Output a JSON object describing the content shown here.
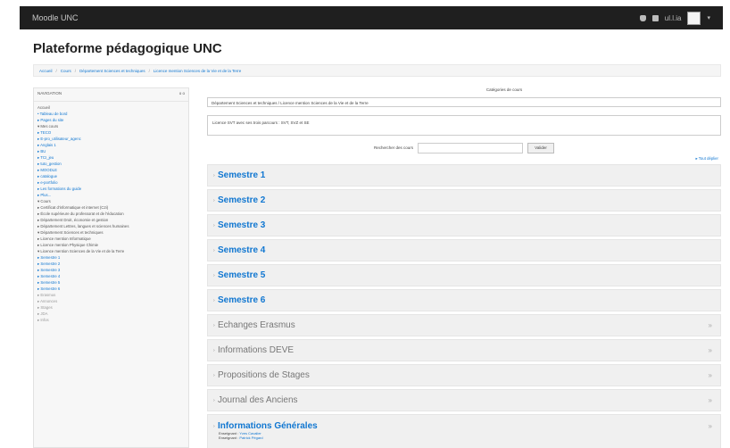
{
  "navbar": {
    "brand": "Moodle UNC",
    "user": "ul.l.ia"
  },
  "page": {
    "title": "Plateforme pédagogique UNC"
  },
  "breadcrumb": [
    "Accueil",
    "Cours",
    "Département Sciences et techniques",
    "Licence mention Sciences de la Vie et de la Terre"
  ],
  "sidebar": {
    "heading": "NAVIGATION",
    "control": "o o",
    "items": [
      {
        "label": "Accueil",
        "cls": "dark"
      },
      {
        "label": "• Tableau de bord",
        "cls": ""
      },
      {
        "label": "▸ Pages du site",
        "cls": ""
      },
      {
        "label": "▾ Mes cours",
        "cls": "dark"
      },
      {
        "label": "   ▸ TECO",
        "cls": ""
      },
      {
        "label": "   ▸ E-pro_utilisateur_agenc",
        "cls": ""
      },
      {
        "label": "   ▸ Anglais 1",
        "cls": ""
      },
      {
        "label": "   ▸ BU",
        "cls": ""
      },
      {
        "label": "   ▸ TCI_jeu",
        "cls": ""
      },
      {
        "label": "   ▸ tuto_gestion",
        "cls": ""
      },
      {
        "label": "   ▸ MOODLE",
        "cls": ""
      },
      {
        "label": "   ▸ catalogue",
        "cls": ""
      },
      {
        "label": "   ▸ e-portfolio",
        "cls": ""
      },
      {
        "label": "   ▸ Les formations du guide",
        "cls": ""
      },
      {
        "label": "   ▸ Plus...",
        "cls": ""
      },
      {
        "label": "▾ Cours",
        "cls": "dark"
      },
      {
        "label": "   ▸ Certificat d'informatique et internet (C2i)",
        "cls": "dark"
      },
      {
        "label": "   ▸ École supérieure du professorat et de l'éducation",
        "cls": "dark wrap"
      },
      {
        "label": "   ▸ Département Droit, économie et gestion",
        "cls": "dark"
      },
      {
        "label": "   ▸ Département Lettres, langues et sciences humaines",
        "cls": "dark wrap"
      },
      {
        "label": "   ▾ Département Sciences et techniques",
        "cls": "dark"
      },
      {
        "label": "      ▸ Licence mention Informatique",
        "cls": "dark"
      },
      {
        "label": "      ▸ Licence mention Physique Chimie",
        "cls": "dark"
      },
      {
        "label": "      ▾ Licence mention Sciences de la Vie et de la Terre",
        "cls": "dark wrap"
      },
      {
        "label": "         ▸ Semestre 1",
        "cls": ""
      },
      {
        "label": "         ▸ Semestre 2",
        "cls": ""
      },
      {
        "label": "         ▸ Semestre 3",
        "cls": ""
      },
      {
        "label": "         ▸ Semestre 4",
        "cls": ""
      },
      {
        "label": "         ▸ Semestre 5",
        "cls": ""
      },
      {
        "label": "         ▸ Semestre 6",
        "cls": ""
      },
      {
        "label": "         ▸ Erasmus",
        "cls": "grey"
      },
      {
        "label": "         ▸ Annonces",
        "cls": "grey"
      },
      {
        "label": "         ▸ Stages",
        "cls": "grey"
      },
      {
        "label": "         ▸ JDA",
        "cls": "grey"
      },
      {
        "label": "         ▸ Infos",
        "cls": "grey"
      }
    ]
  },
  "main": {
    "category_label": "Catégories de cours",
    "category_selected": "Département Sciences et techniques / Licence mention Sciences de la Vie et de la Terre",
    "info_text": "Licence SVT avec ses trois parcours : SVT, SVZ et SE",
    "search_label": "Rechercher des cours",
    "search_placeholder": "",
    "search_button": "Valider",
    "collapse_all": "▸ Tout déplier",
    "sections": [
      {
        "name": "Semestre 1",
        "style": "strong"
      },
      {
        "name": "Semestre 2",
        "style": "strong"
      },
      {
        "name": "Semestre 3",
        "style": "strong"
      },
      {
        "name": "Semestre 4",
        "style": "strong"
      },
      {
        "name": "Semestre 5",
        "style": "strong"
      },
      {
        "name": "Semestre 6",
        "style": "strong"
      },
      {
        "name": "Echanges Erasmus",
        "style": "plain"
      },
      {
        "name": "Informations DEVE",
        "style": "plain"
      },
      {
        "name": "Propositions de Stages",
        "style": "plain"
      },
      {
        "name": "Journal des Anciens",
        "style": "plain"
      }
    ],
    "featured": {
      "name": "Informations Générales",
      "teachers": [
        {
          "role": "Enseignant :",
          "name": "Yves Cavalier"
        },
        {
          "role": "Enseignant :",
          "name": "Patrick Pégard"
        }
      ]
    }
  },
  "colors": {
    "link": "#1177d1",
    "navbar": "#1f1f1f",
    "section_bg": "#f0f0f0"
  }
}
